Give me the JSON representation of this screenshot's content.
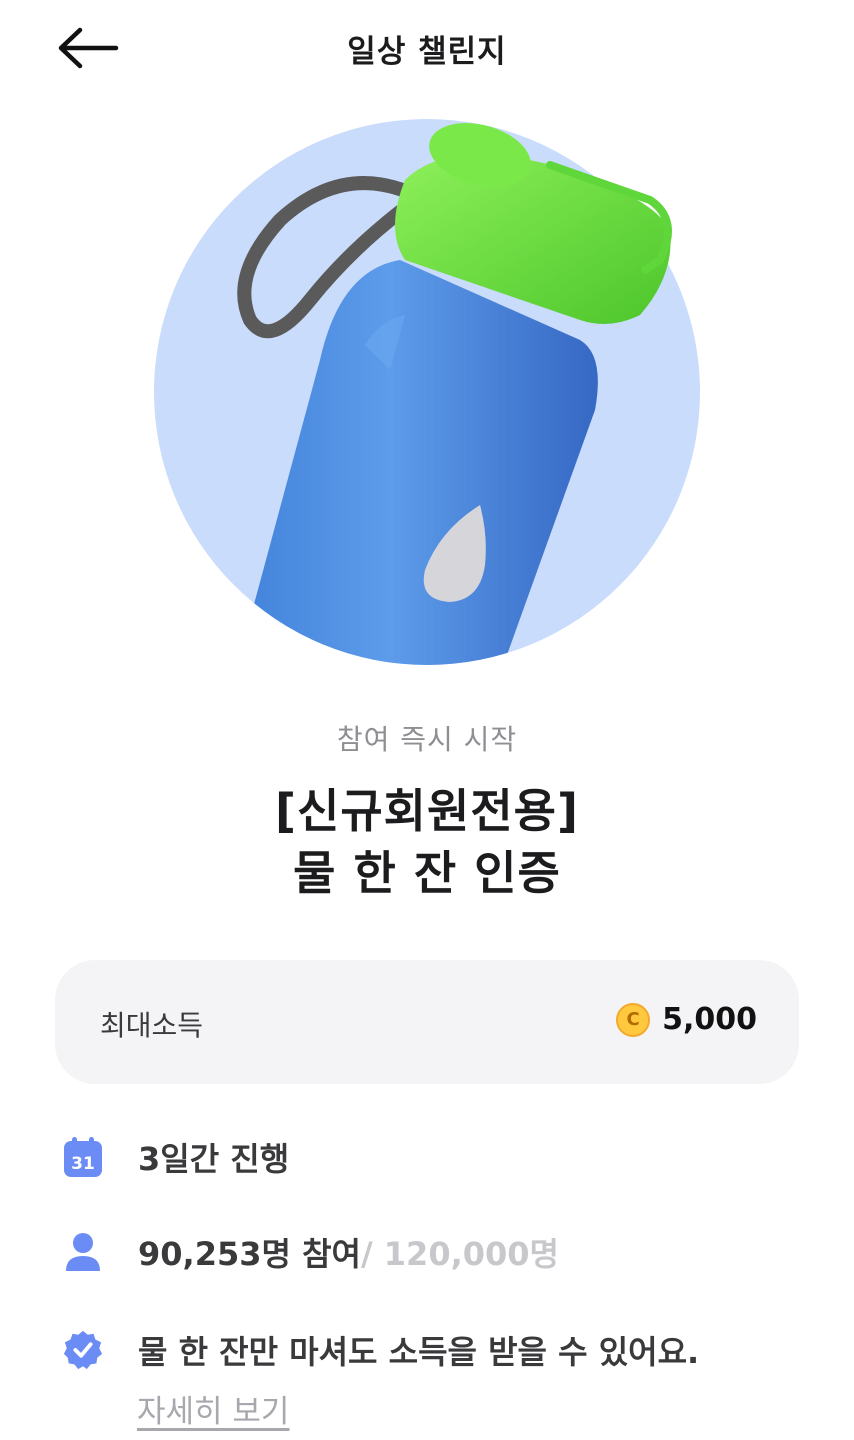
{
  "header": {
    "title": "일상 챌린지",
    "back_icon": "arrow-left-icon"
  },
  "hero": {
    "image": "water-bottle-illustration",
    "circle_color": "#c9dcfb",
    "bottle_color": "#4f8fe0",
    "cap_color": "#6fde3f"
  },
  "challenge": {
    "subtitle": "참여 즉시 시작",
    "title_line1": "[신규회원전용]",
    "title_line2": "물 한 잔 인증"
  },
  "reward": {
    "label": "최대소득",
    "coin_symbol": "C",
    "amount": "5,000",
    "coin_color": "#ffc83d"
  },
  "info": {
    "duration": {
      "icon": "calendar-icon",
      "calendar_day": "31",
      "text": "3일간 진행"
    },
    "participants": {
      "icon": "person-icon",
      "count_text": "90,253명 참여",
      "max_text": "/ 120,000명"
    },
    "description": {
      "icon": "verified-badge-icon",
      "text": "물 한 잔만 마셔도 소득을 받을 수 있어요.",
      "link_text": "자세히 보기"
    },
    "accent_color": "#6b8cf5"
  }
}
